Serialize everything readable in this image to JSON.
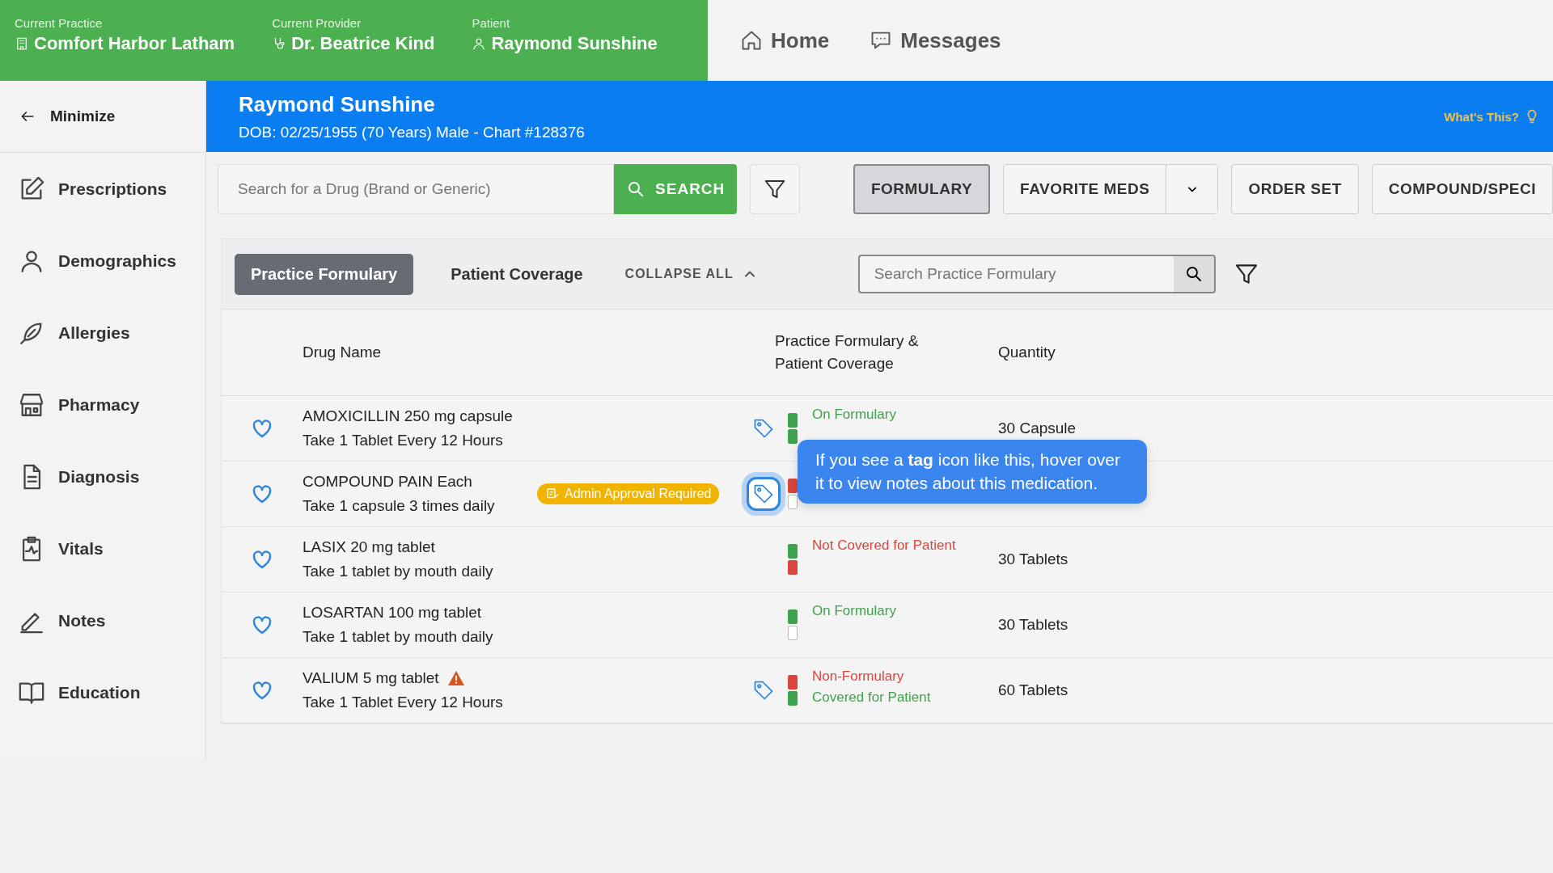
{
  "context_bar": [
    {
      "label": "Current Practice",
      "value": "Comfort Harbor Latham"
    },
    {
      "label": "Current Provider",
      "value": "Dr. Beatrice Kind"
    },
    {
      "label": "Patient",
      "value": "Raymond Sunshine"
    }
  ],
  "top_nav": [
    "Home",
    "Messages"
  ],
  "sidebar": {
    "minimize": "Minimize",
    "items": [
      "Prescriptions",
      "Demographics",
      "Allergies",
      "Pharmacy",
      "Diagnosis",
      "Vitals",
      "Notes",
      "Education"
    ]
  },
  "patient_header": {
    "name": "Raymond Sunshine",
    "details": "DOB: 02/25/1955 (70 Years) Male - Chart #128376",
    "help": "What's This?"
  },
  "search": {
    "placeholder": "Search for a Drug (Brand or Generic)",
    "button": "SEARCH"
  },
  "mode_buttons": [
    {
      "label": "FORMULARY",
      "selected": true,
      "dropdown": false
    },
    {
      "label": "FAVORITE MEDS",
      "selected": false,
      "dropdown": true
    },
    {
      "label": "ORDER SET",
      "selected": false,
      "dropdown": false
    },
    {
      "label": "COMPOUND/SPECI",
      "selected": false,
      "dropdown": false
    }
  ],
  "tabs": [
    {
      "label": "Practice Formulary",
      "selected": true
    },
    {
      "label": "Patient Coverage",
      "selected": false
    }
  ],
  "collapse_all": "COLLAPSE ALL",
  "formulary_search": {
    "placeholder": "Search Practice Formulary"
  },
  "table": {
    "columns": [
      "Drug Name",
      "Practice Formulary & Patient Coverage",
      "Quantity"
    ],
    "rows": [
      {
        "name": "AMOXICILLIN",
        "strength": "250 mg capsule",
        "sig": "Take 1 Tablet Every 12 Hours",
        "warning": false,
        "tag": true,
        "tag_selected": false,
        "segments": [
          {
            "color": "#3fa34d"
          },
          {
            "color": "#3fa34d"
          }
        ],
        "status": [
          {
            "text": "On Formulary",
            "color": "#3fa34d"
          }
        ],
        "quantity": "30 Capsule"
      },
      {
        "name": "COMPOUND PAIN",
        "strength": "Each",
        "sig": "Take 1 capsule 3 times daily",
        "badge": "Admin Approval Required",
        "warning": false,
        "tag": true,
        "tag_selected": true,
        "segments": [
          {
            "color": "#d9463e"
          }
        ],
        "status": []
      },
      {
        "name": "LASIX",
        "strength": "20 mg tablet",
        "sig": "Take 1 tablet by mouth daily",
        "warning": false,
        "tag": false,
        "segments": [
          {
            "color": "#3fa34d"
          },
          {
            "color": "#d9463e"
          }
        ],
        "status": [
          {
            "text": "Not Covered for Patient",
            "color": "#d9463e"
          }
        ],
        "quantity": "30 Tablets"
      },
      {
        "name": "LOSARTAN",
        "strength": "100 mg tablet",
        "sig": "Take 1 tablet by mouth daily",
        "warning": false,
        "tag": false,
        "segments": [
          {
            "color": "#3fa34d"
          }
        ],
        "status": [
          {
            "text": "On Formulary",
            "color": "#3fa34d"
          }
        ],
        "quantity": "30 Tablets"
      },
      {
        "name": "VALIUM",
        "strength": "5 mg tablet",
        "sig": "Take 1 Tablet Every 12 Hours",
        "warning": true,
        "tag": true,
        "tag_selected": false,
        "segments": [
          {
            "color": "#d9463e"
          },
          {
            "color": "#3fa34d"
          }
        ],
        "status": [
          {
            "text": "Non-Formulary",
            "color": "#d9463e"
          },
          {
            "text": "Covered for Patient",
            "color": "#3fa34d"
          }
        ],
        "quantity": "60 Tablets"
      }
    ]
  },
  "tooltip": {
    "text": "If you see a **tag** icon like this, hover over it to view notes about this medication."
  }
}
